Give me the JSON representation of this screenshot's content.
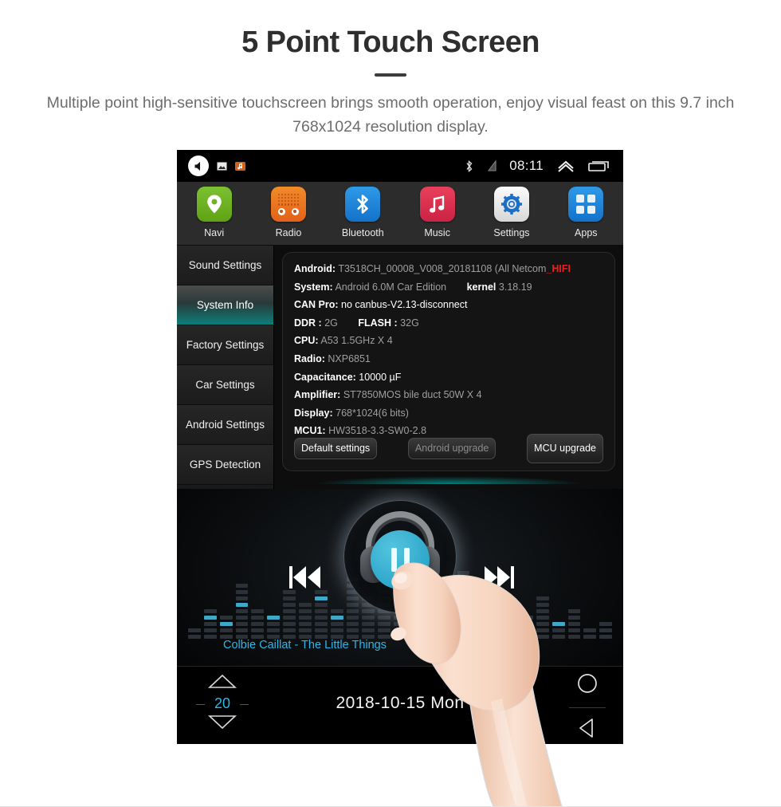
{
  "promo": {
    "title": "5 Point Touch Screen",
    "subtitle": "Multiple point high-sensitive touchscreen brings smooth operation, enjoy visual feast on this 9.7 inch 768x1024 resolution display."
  },
  "statusbar": {
    "mute_icon": "speaker-mute-icon",
    "screenshot_icon": "screenshot-icon",
    "music_notification_icon": "music-notification-icon",
    "bluetooth_icon": "bluetooth-icon",
    "signal_icon": "no-signal-icon",
    "time": "08:11",
    "collapse_icon": "chevron-up-icon",
    "recents_icon": "recents-icon"
  },
  "apps": [
    {
      "label": "Navi",
      "icon": "location-pin-icon",
      "color": "#6fb328"
    },
    {
      "label": "Radio",
      "icon": "radio-icon",
      "color": "#e8701f"
    },
    {
      "label": "Bluetooth",
      "icon": "bluetooth-icon",
      "color": "#1f85d8"
    },
    {
      "label": "Music",
      "icon": "music-note-icon",
      "color": "#dd3353"
    },
    {
      "label": "Settings",
      "icon": "gear-icon",
      "color": "#e9e9e9"
    },
    {
      "label": "Apps",
      "icon": "grid-apps-icon",
      "color": "#1f85d8"
    }
  ],
  "sidebar": {
    "items": [
      {
        "label": "Sound Settings",
        "active": false
      },
      {
        "label": "System Info",
        "active": true
      },
      {
        "label": "Factory Settings",
        "active": false
      },
      {
        "label": "Car Settings",
        "active": false
      },
      {
        "label": "Android Settings",
        "active": false
      },
      {
        "label": "GPS Detection",
        "active": false
      }
    ],
    "active_color": "#0c7f7a"
  },
  "system_info": {
    "rows": [
      {
        "key": "Android:",
        "value": "T3518CH_00008_V008_20181108  (All Netcom",
        "suffix": "_HIFI"
      },
      {
        "key": "System:",
        "value": "Android 6.0M Car Edition",
        "key2": "kernel",
        "value2": "3.18.19"
      },
      {
        "key": "CAN Pro:",
        "value": "no canbus-V2.13-disconnect",
        "bright": true
      },
      {
        "key": "DDR :",
        "value": "2G",
        "key2": "FLASH :",
        "value2": "32G"
      },
      {
        "key": "CPU:",
        "value": "A53 1.5GHz X 4"
      },
      {
        "key": "Radio:",
        "value": "NXP6851"
      },
      {
        "key": "Capacitance:",
        "value": "10000 µF",
        "bright": true
      },
      {
        "key": "Amplifier:",
        "value": "ST7850MOS bile duct 50W X 4"
      },
      {
        "key": "Display:",
        "value": "768*1024(6 bits)"
      },
      {
        "key": "MCU1:",
        "value": "HW3518-3.3-SW0-2.8"
      }
    ],
    "buttons": [
      {
        "label": "Default settings",
        "state": "enabled"
      },
      {
        "label": "Android upgrade",
        "state": "disabled"
      },
      {
        "label": "MCU upgrade",
        "state": "enabled"
      }
    ]
  },
  "player": {
    "track": "Colbie Caillat - The Little Things",
    "prev_icon": "previous-track-icon",
    "play_icon": "pause-icon",
    "next_icon": "next-track-icon",
    "accent_color": "#2bb7e8"
  },
  "bottombar": {
    "volume_up_icon": "triangle-up-icon",
    "volume_value": "20",
    "volume_down_icon": "triangle-down-icon",
    "datetime": "2018-10-15  Mon",
    "home_icon": "home-circle-icon",
    "back_icon": "back-triangle-icon"
  }
}
